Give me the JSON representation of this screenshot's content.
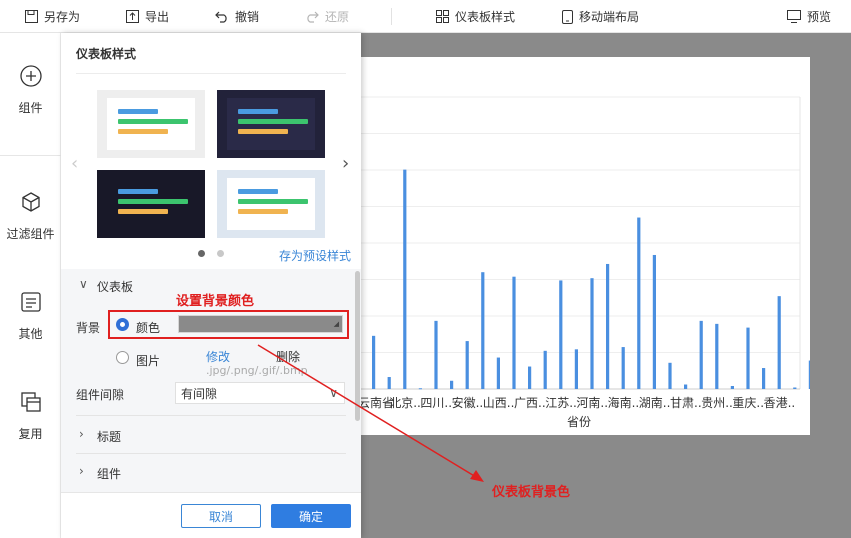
{
  "toolbar": {
    "save_as": "另存为",
    "export": "导出",
    "undo": "撤销",
    "redo": "还原",
    "dashboard_style": "仪表板样式",
    "mobile_layout": "移动端布局",
    "preview": "预览"
  },
  "sidebar": {
    "items": [
      {
        "label": "组件",
        "icon": "plus-circle-icon"
      },
      {
        "label": "过滤组件",
        "icon": "cube-icon"
      },
      {
        "label": "其他",
        "icon": "document-icon"
      },
      {
        "label": "复用",
        "icon": "copy-icon"
      }
    ]
  },
  "panel": {
    "title": "仪表板样式",
    "save_preset": "存为预设样式",
    "section_dashboard": "仪表板",
    "background_label": "背景",
    "color_option": "颜色",
    "image_option": "图片",
    "modify": "修改",
    "delete": "删除",
    "image_hint": ".jpg/.png/.gif/.bmp",
    "spacing_label": "组件间隙",
    "spacing_value": "有间隙",
    "section_title": "标题",
    "section_component": "组件",
    "cancel": "取消",
    "confirm": "确定",
    "background_color": "#8a8a8a",
    "themes": [
      {
        "name": "light-gray",
        "bg": "#eeeeee",
        "inner": "#ffffff"
      },
      {
        "name": "dark-navy",
        "bg": "#22223a",
        "inner": "#2a2a48"
      },
      {
        "name": "dark-black",
        "bg": "#181828",
        "inner": "#181828"
      },
      {
        "name": "light-blue",
        "bg": "#dde6f0",
        "inner": "#ffffff"
      }
    ]
  },
  "annotations": {
    "set_bg_color": "设置背景颜色",
    "dashboard_bg_color": "仪表板背景色"
  },
  "chart_data": {
    "type": "bar",
    "xlabel": "省份",
    "ylabel": "",
    "series_color": "#4a8fe0",
    "categories": [
      "云南省",
      "北京..",
      "四川..",
      "安徽..",
      "山西..",
      "广西..",
      "江苏..",
      "河南..",
      "海南..",
      "湖南..",
      "甘肃..",
      "贵州..",
      "重庆..",
      "香港.."
    ],
    "values": [
      71,
      16,
      293,
      1,
      91,
      11,
      64,
      156,
      42,
      150,
      30,
      51,
      145,
      53,
      148,
      167,
      56,
      229,
      179,
      35,
      6,
      91,
      87,
      4,
      82,
      28,
      124,
      2,
      38
    ],
    "ylim": [
      0,
      390
    ]
  }
}
